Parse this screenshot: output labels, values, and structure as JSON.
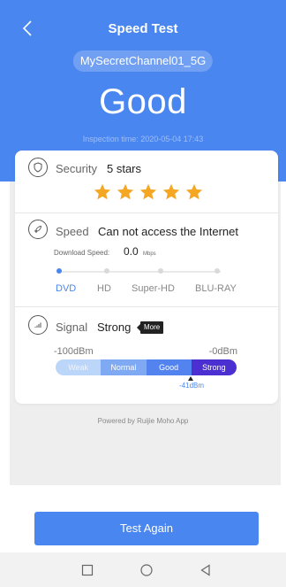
{
  "header": {
    "title": "Speed Test",
    "ssid": "MySecretChannel01_5G",
    "rating": "Good",
    "inspection_time": "Inspection time: 2020-05-04 17:43",
    "back_icon": "chevron-left-icon"
  },
  "security": {
    "icon": "shield-icon",
    "label": "Security",
    "value": "5 stars",
    "stars": 5,
    "star_color": "#f5a623"
  },
  "speed": {
    "icon": "rocket-icon",
    "label": "Speed",
    "value": "Can not access the Internet",
    "download_label": "Download Speed:",
    "download_value": "0.0",
    "download_unit": "Mbps",
    "tiers": [
      "DVD",
      "HD",
      "Super-HD",
      "BLU-RAY"
    ],
    "active_tier": 0
  },
  "signal": {
    "icon": "signal-icon",
    "label": "Signal",
    "value": "Strong",
    "more_label": "More",
    "min_label": "-100dBm",
    "max_label": "-0dBm",
    "levels": [
      "Weak",
      "Normal",
      "Good",
      "Strong"
    ],
    "current_label": "-41dBm"
  },
  "footer": {
    "powered_by": "Powered by Ruijie Moho App",
    "test_again_label": "Test Again"
  },
  "colors": {
    "accent": "#4a86f0",
    "strong": "#4b2fd0"
  },
  "navbar": {
    "icons": [
      "recent-apps-icon",
      "home-icon",
      "back-icon"
    ]
  }
}
